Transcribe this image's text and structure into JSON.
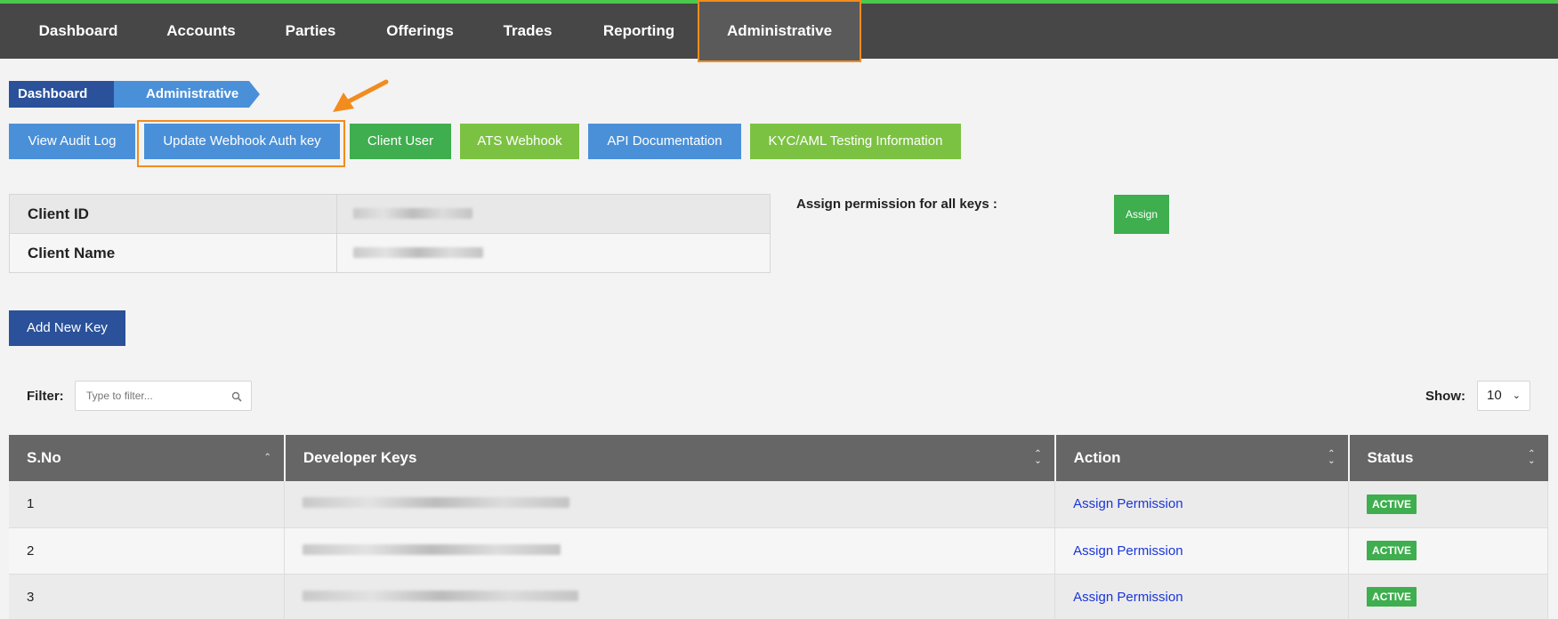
{
  "nav": {
    "items": [
      "Dashboard",
      "Accounts",
      "Parties",
      "Offerings",
      "Trades",
      "Reporting",
      "Administrative"
    ],
    "active": "Administrative"
  },
  "breadcrumb": [
    "Dashboard",
    "Administrative"
  ],
  "toolbar": {
    "view_audit_log": "View Audit Log",
    "update_webhook": "Update Webhook Auth key",
    "client_user": "Client User",
    "ats_webhook": "ATS Webhook",
    "api_docs": "API Documentation",
    "kyc_info": "KYC/AML Testing Information"
  },
  "client_info": {
    "id_label": "Client ID",
    "name_label": "Client Name"
  },
  "assign": {
    "label": "Assign permission for all keys :",
    "button": "Assign"
  },
  "add_key_button": "Add New Key",
  "filter": {
    "label": "Filter:",
    "placeholder": "Type to filter..."
  },
  "show": {
    "label": "Show:",
    "value": "10"
  },
  "table": {
    "headers": [
      "S.No",
      "Developer Keys",
      "Action",
      "Status"
    ],
    "rows": [
      {
        "sno": "1",
        "action": "Assign Permission",
        "status": "ACTIVE"
      },
      {
        "sno": "2",
        "action": "Assign Permission",
        "status": "ACTIVE"
      },
      {
        "sno": "3",
        "action": "Assign Permission",
        "status": "ACTIVE"
      }
    ]
  },
  "colors": {
    "nav_bg": "#474747",
    "highlight": "#f28c1e",
    "primary_blue": "#4a90d9",
    "navy": "#2a5199",
    "green": "#3eae4e",
    "lime": "#7cc242"
  }
}
